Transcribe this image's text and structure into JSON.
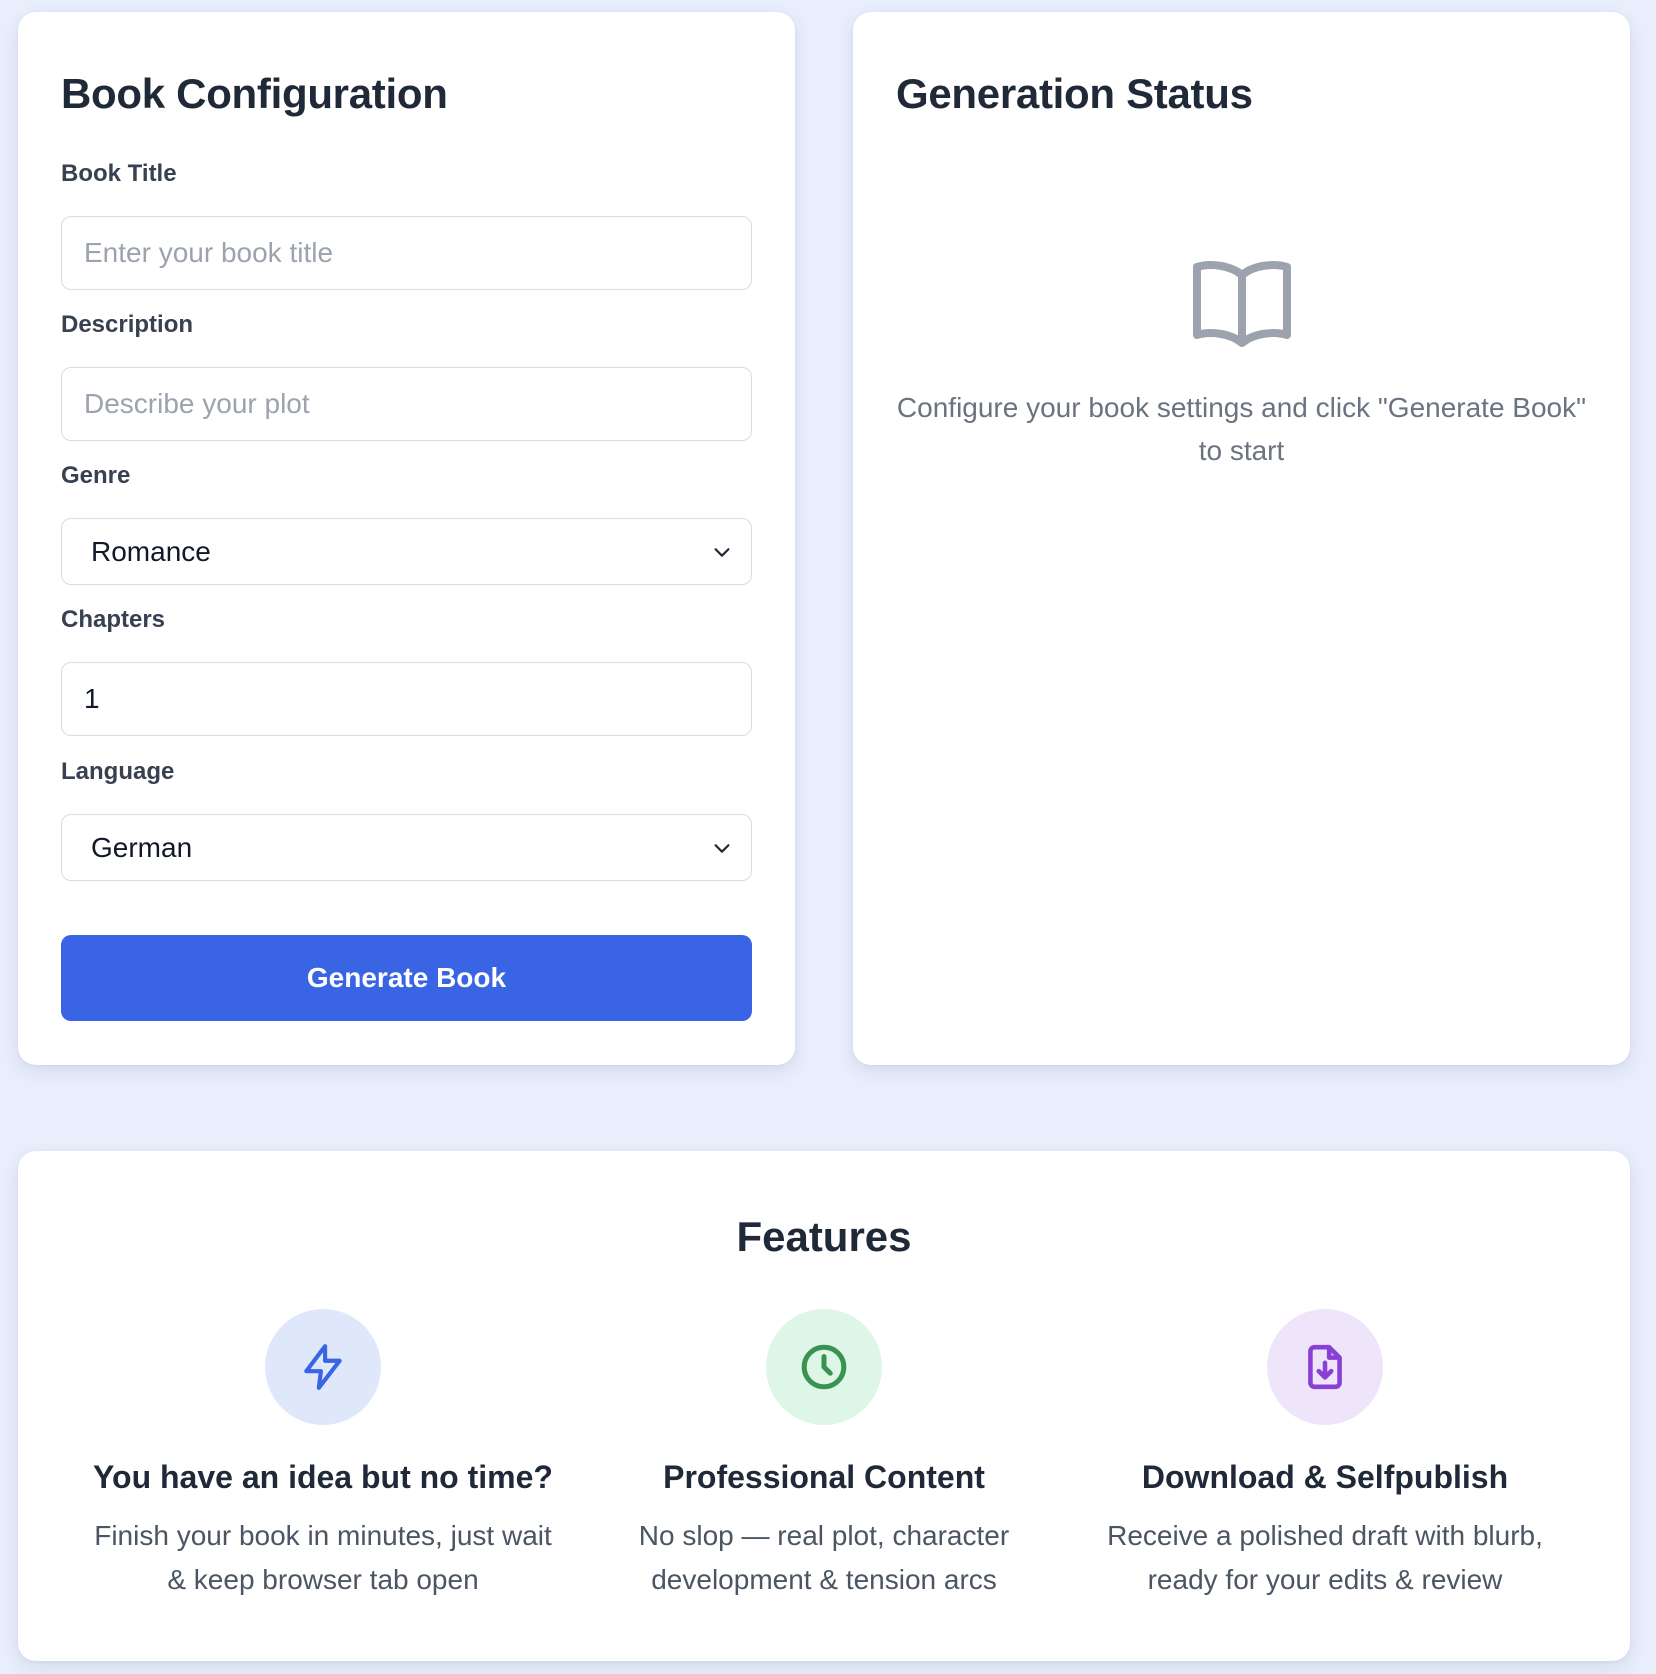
{
  "config": {
    "title": "Book Configuration",
    "book_title": {
      "label": "Book Title",
      "placeholder": "Enter your book title",
      "value": ""
    },
    "description": {
      "label": "Description",
      "placeholder": "Describe your plot",
      "value": ""
    },
    "genre": {
      "label": "Genre",
      "selected": "Romance"
    },
    "chapters": {
      "label": "Chapters",
      "value": "1"
    },
    "language": {
      "label": "Language",
      "selected": "German"
    },
    "generate_label": "Generate Book"
  },
  "status": {
    "title": "Generation Status",
    "icon": "open-book-icon",
    "message": "Configure your book settings and click \"Generate Book\" to start"
  },
  "features": {
    "title": "Features",
    "items": [
      {
        "icon": "lightning-icon",
        "title": "You have an idea but no time?",
        "desc": "Finish your book in minutes, just wait & keep browser tab open"
      },
      {
        "icon": "clock-icon",
        "title": "Professional Content",
        "desc": "No slop — real plot, character development & tension arcs"
      },
      {
        "icon": "file-download-icon",
        "title": "Download & Selfpublish",
        "desc": "Receive a polished draft with blurb, ready for your edits & review"
      }
    ]
  },
  "colors": {
    "page_background": "#e9eefc",
    "primary_button": "#3964e3",
    "feature_1_bg": "#dfe8fb",
    "feature_1_fg": "#3964e3",
    "feature_2_bg": "#def6e6",
    "feature_2_fg": "#3a9354",
    "feature_3_bg": "#efe5fb",
    "feature_3_fg": "#8a3fd6"
  }
}
